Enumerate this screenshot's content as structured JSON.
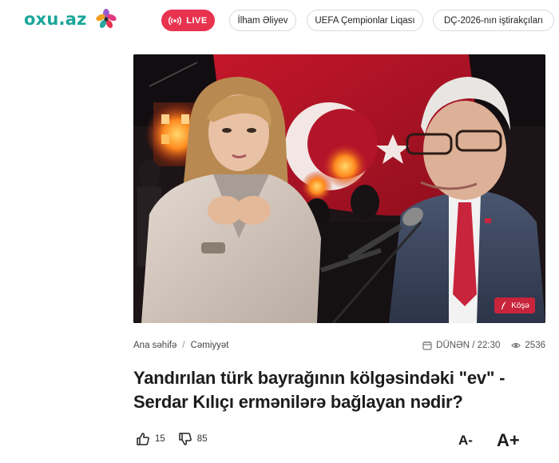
{
  "header": {
    "logo": "oxu.az",
    "live_label": "LIVE",
    "chips": [
      "İlham Əliyev",
      "UEFA Çempionlar Liqası",
      "DÇ-2026-nın iştirakçıları"
    ]
  },
  "hero": {
    "category_badge": "Köşə"
  },
  "meta": {
    "breadcrumb": [
      "Ana səhifə",
      "Cəmiyyət"
    ],
    "date": "DÜNƏN / 22:30",
    "views": "2536"
  },
  "article": {
    "title": "Yandırılan türk bayrağının kölgəsindəki \"ev\" - Serdar Kılıçı ermənilərə bağlayan nədir?"
  },
  "reactions": {
    "likes": "15",
    "dislikes": "85"
  },
  "font_controls": {
    "decrease": "A-",
    "increase": "A+"
  },
  "colors": {
    "brand": "#1ba59a",
    "live": "#e8334f",
    "badge": "#c8243b",
    "flag_red": "#d0182b"
  },
  "icons": [
    "logo-flower-icon",
    "live-broadcast-icon",
    "quill-icon",
    "calendar-icon",
    "eye-icon",
    "thumbs-up-icon",
    "thumbs-down-icon"
  ]
}
